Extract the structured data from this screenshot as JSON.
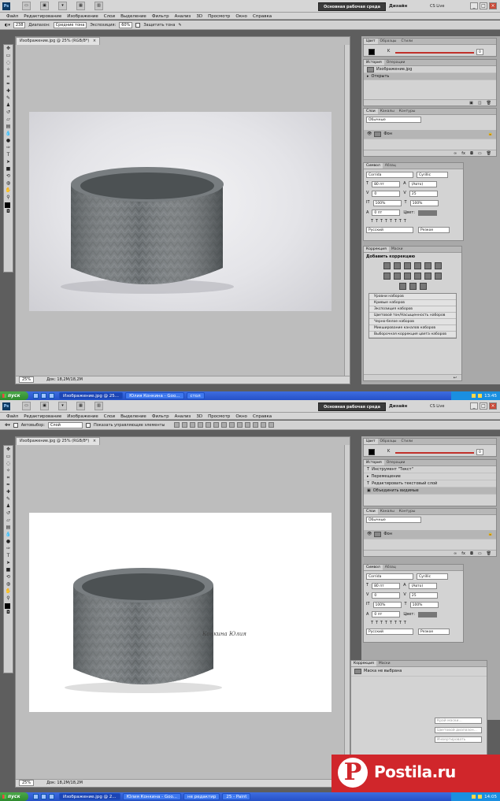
{
  "colors": {
    "accent": "#c0302a",
    "pinterest": "#d0262b",
    "taskbar": "#2650c7"
  },
  "menu": [
    "Файл",
    "Редактирование",
    "Изображение",
    "Слои",
    "Выделение",
    "Фильтр",
    "Анализ",
    "3D",
    "Просмотр",
    "Окно",
    "Справка"
  ],
  "workspace": "Основная рабочая среда",
  "design": "Дизайн",
  "cslive": "CS Live",
  "screen1": {
    "options": {
      "range_label": "Диапазон:",
      "range_value": "Средние тона",
      "exposure_label": "Экспозиция:",
      "exposure_value": "60%",
      "protect_label": "Защитить тона",
      "size": "238"
    },
    "doc_tab": "Изображение.jpg @ 25% (RGB/8*)",
    "zoom": "25%",
    "doc_size": "Док: 18,2М/18,2М",
    "color_tabs": [
      "Цвет",
      "Образцы",
      "Стили"
    ],
    "color_k": "K",
    "color_k_val": "0",
    "history_tabs": [
      "История",
      "Операции"
    ],
    "history_items": [
      "Изображение.jpg",
      "Открыть"
    ],
    "layers_tabs": [
      "Слои",
      "Каналы",
      "Контуры"
    ],
    "layers_mode": "Обычные",
    "layer_name": "Фон",
    "char_tabs": [
      "Символ",
      "Абзац"
    ],
    "char": {
      "font": "Corrida",
      "style": "Cyrillic",
      "size": "80 пт",
      "leading": "(Авто)",
      "kerning": "0",
      "tracking": "25",
      "vscale": "100%",
      "hscale": "100%",
      "baseline": "0 пт",
      "color_label": "Цвет:",
      "lang": "Русский",
      "aa": "Резкое"
    },
    "adj_tabs": [
      "Коррекция",
      "Маски"
    ],
    "adj_title": "Добавить коррекцию",
    "presets": [
      "Уровни наборов",
      "Кривые наборов",
      "Экспозиция наборов",
      "Цветовой тон/Насыщенность наборов",
      "Черно-белое наборов",
      "Микширование каналов наборов",
      "Выборочная коррекция цвета наборов"
    ],
    "taskbar": {
      "start": "пуск",
      "items": [
        "Изображение.jpg @ 25...",
        "Юлия Конкина - Goo...",
        "стол"
      ],
      "clock": "13:45"
    }
  },
  "screen2": {
    "options": {
      "autoselect": "Автовыбор:",
      "layer_value": "Слой",
      "show_controls": "Показать управляющие элементы"
    },
    "doc_tab": "Изображение.jpg @ 25% (RGB/8*)",
    "zoom": "25%",
    "doc_size": "Док: 18,2М/18,2М",
    "color_tabs": [
      "Цвет",
      "Образцы",
      "Стили"
    ],
    "color_k": "K",
    "color_k_val": "0",
    "history_tabs": [
      "История",
      "Операции"
    ],
    "history_items": [
      "Инструмент \"Текст\"",
      "Перемещение",
      "Редактировать текстовый слой",
      "Объединить видимые"
    ],
    "layers_tabs": [
      "Слои",
      "Каналы",
      "Контуры"
    ],
    "layers_mode": "Обычные",
    "layer_name": "Фон",
    "char_tabs": [
      "Символ",
      "Абзац"
    ],
    "char": {
      "font": "Corrida",
      "style": "Cyrillic",
      "size": "80 пт",
      "leading": "(Авто)",
      "kerning": "0",
      "tracking": "25",
      "vscale": "100%",
      "hscale": "100%",
      "baseline": "0 пт",
      "color_label": "Цвет:",
      "lang": "Русский",
      "aa": "Резкое"
    },
    "mask_tabs": [
      "Коррекция",
      "Маски"
    ],
    "mask_title": "Маска не выбрана",
    "mask_buttons": [
      "Край маски...",
      "Цветовой диапазон...",
      "Инвертировать"
    ],
    "signature": "Конкина Юлия",
    "taskbar": {
      "start": "пуск",
      "items": [
        "Изображение.jpg @ 2...",
        "Юлия Конкина - Goo...",
        "не редактир",
        "25 - Paint"
      ],
      "clock": "14:05"
    }
  },
  "watermark": {
    "letter": "P",
    "text": "Postila.ru"
  }
}
